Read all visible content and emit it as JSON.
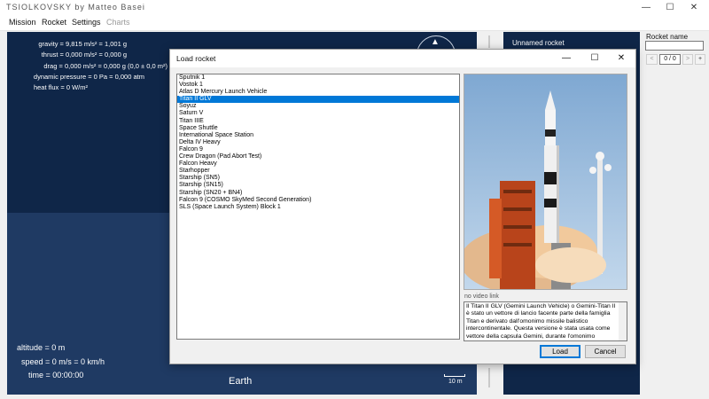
{
  "app": {
    "title": "TSIOLKOVSKY by Matteo Basei"
  },
  "window_controls": {
    "minimize": "—",
    "maximize": "☐",
    "close": "✕"
  },
  "menu": {
    "mission": "Mission",
    "rocket": "Rocket",
    "settings": "Settings",
    "charts": "Charts"
  },
  "readouts": {
    "gravity": "gravity = 9,815 m/s² = 1,001 g",
    "thrust": "thrust = 0,000 m/s² = 0,000 g",
    "drag": "drag = 0,000 m/s² = 0,000 g (0,0 ± 0,0 m²)",
    "dynamic_pressure": "dynamic pressure = 0 Pa = 0,000 atm",
    "heat_flux": "heat flux = 0 W/m²",
    "altitude": "altitude = 0 m",
    "speed": "speed = 0 m/s = 0 km/h",
    "time": "time = 00:00:00"
  },
  "view": {
    "body_name": "Earth",
    "scale_label": "10 m"
  },
  "rocket_panel": {
    "header": "Unnamed rocket",
    "name_label": "Rocket name",
    "name_value": "",
    "prev_icon": "<",
    "counter": "0 / 0",
    "next_icon": ">",
    "add_icon": "+"
  },
  "dialog": {
    "title": "Load rocket",
    "controls": {
      "minimize": "—",
      "maximize": "☐",
      "close": "✕"
    },
    "rockets": [
      "Sputnik 1",
      "Vostok 1",
      "Atlas D Mercury Launch Vehicle",
      "Titan II GLV",
      "Soyuz",
      "Saturn V",
      "Titan IIIE",
      "Space Shuttle",
      "International Space Station",
      "Delta IV Heavy",
      "Falcon 9",
      "Crew Dragon (Pad Abort Test)",
      "Falcon Heavy",
      "Starhopper",
      "Starship (SN5)",
      "Starship (SN15)",
      "Starship (SN20 + BN4)",
      "Falcon 9 (COSMO SkyMed Second Generation)",
      "SLS (Space Launch System) Block 1"
    ],
    "selected_index": 3,
    "video_link": "no video link",
    "description": "Il Titan II GLV (Gemini Launch Vehicle) o Gemini-Titan II è stato un vettore di lancio facente parte della famiglia Titan e derivato dall'omonimo missile balistico intercontinentale. Questa versione è stata usata come vettore della capsula Gemini, durante l'omonimo progetto portato avanti dagli",
    "load_label": "Load",
    "cancel_label": "Cancel"
  },
  "colors": {
    "sim_dark": "#0f2648",
    "sim_ground": "#1f3a63",
    "selection": "#0078d7",
    "sky": "#8fb4d9",
    "tower": "#c0401a"
  }
}
